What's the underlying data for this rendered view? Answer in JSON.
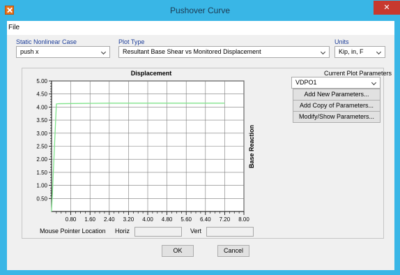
{
  "window": {
    "title": "Pushover Curve",
    "close_label": "✕",
    "icon": "app-x-icon"
  },
  "menu": {
    "file_label": "File"
  },
  "case": {
    "label": "Static Nonlinear Case",
    "value": "push x"
  },
  "plot_type": {
    "label": "Plot Type",
    "value": "Resultant Base Shear vs Monitored Displacement"
  },
  "units": {
    "label": "Units",
    "value": "Kip, in, F"
  },
  "params": {
    "label": "Current Plot Parameters",
    "selected": "VDPO1",
    "add_new": "Add New Parameters...",
    "add_copy": "Add Copy of Parameters...",
    "modify": "Modify/Show Parameters..."
  },
  "mouse": {
    "label": "Mouse Pointer Location",
    "horiz_label": "Horiz",
    "vert_label": "Vert",
    "horiz_value": "",
    "vert_value": ""
  },
  "buttons": {
    "ok": "OK",
    "cancel": "Cancel"
  },
  "colors": {
    "titlebar": "#39b6e6",
    "curve": "#7fe38a",
    "label_blue": "#1b3c98"
  },
  "chart_data": {
    "type": "line",
    "title": "Displacement",
    "xlabel": "",
    "ylabel": "Base Reaction",
    "xlim": [
      0,
      8.0
    ],
    "ylim": [
      0.0,
      5.0
    ],
    "x_ticks": [
      "0.80",
      "1.60",
      "2.40",
      "3.20",
      "4.00",
      "4.80",
      "5.60",
      "6.40",
      "7.20",
      "8.00"
    ],
    "y_ticks": [
      "0.50",
      "1.00",
      "1.50",
      "2.00",
      "2.50",
      "3.00",
      "3.50",
      "4.00",
      "4.50",
      "5.00"
    ],
    "grid": true,
    "series": [
      {
        "x": [
          0.0,
          0.2,
          0.3,
          2.4,
          7.2
        ],
        "y": [
          0.0,
          4.12,
          4.13,
          4.15,
          4.15
        ]
      }
    ]
  }
}
